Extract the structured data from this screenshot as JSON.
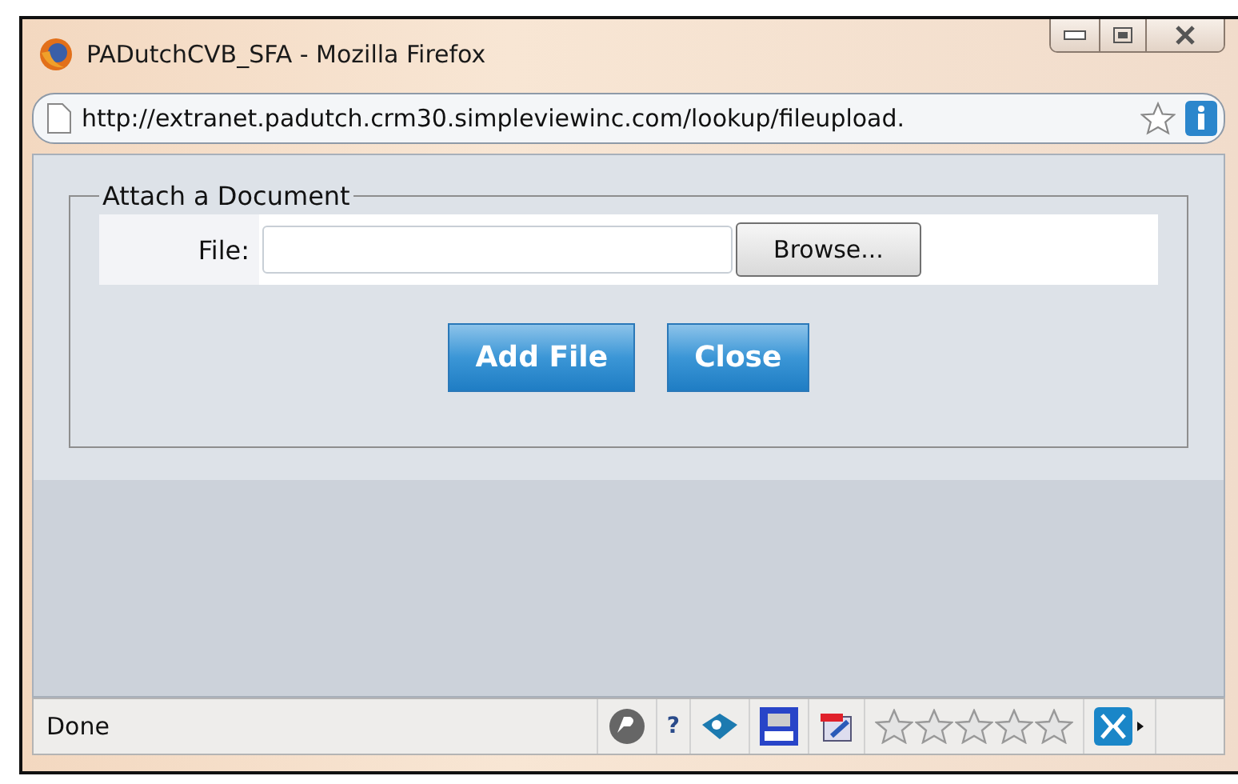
{
  "window": {
    "title": "PADutchCVB_SFA - Mozilla Firefox"
  },
  "address_bar": {
    "url": "http://extranet.padutch.crm30.simpleviewinc.com/lookup/fileupload."
  },
  "form": {
    "legend": "Attach a Document",
    "file_label": "File:",
    "browse_button": "Browse...",
    "buttons": [
      "Add File",
      "Close"
    ]
  },
  "status_bar": {
    "text": "Done",
    "help": "?",
    "rating": {
      "stars": 0
    }
  }
}
